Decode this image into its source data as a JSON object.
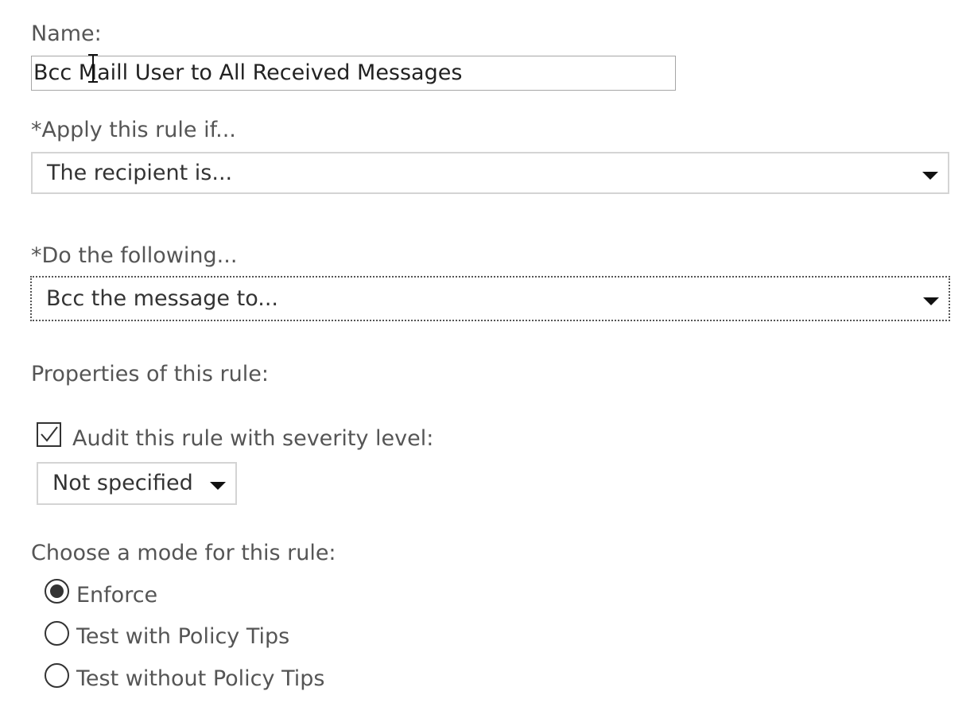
{
  "name_field": {
    "label": "Name:",
    "value": "Bcc Maill User to All Received Messages"
  },
  "apply_rule": {
    "label": "*Apply this rule if...",
    "selected": "The recipient is..."
  },
  "do_following": {
    "label": "*Do the following...",
    "selected": "Bcc the message to..."
  },
  "properties": {
    "label": "Properties of this rule:",
    "audit_checked": true,
    "audit_label": "Audit this rule with severity level:",
    "severity_selected": "Not specified"
  },
  "mode": {
    "label": "Choose a mode for this rule:",
    "options": [
      {
        "label": "Enforce",
        "selected": true
      },
      {
        "label": "Test with Policy Tips",
        "selected": false
      },
      {
        "label": "Test without Policy Tips",
        "selected": false
      }
    ]
  },
  "icons": {
    "checkbox_check": "checkmark-icon",
    "dropdown_arrow": "caret-down-icon",
    "text_cursor": "ibeam-cursor-icon"
  }
}
